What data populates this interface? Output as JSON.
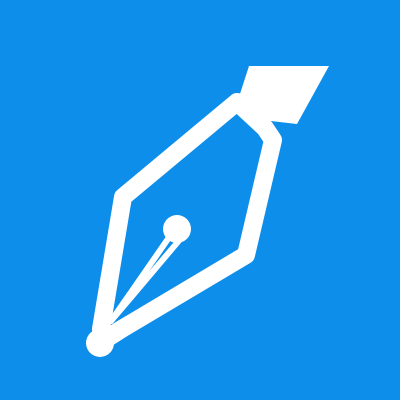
{
  "icon": {
    "name": "fountain-pen-nib-icon",
    "background_color": "#0D8EEB",
    "glyph_color": "#FFFFFF"
  }
}
